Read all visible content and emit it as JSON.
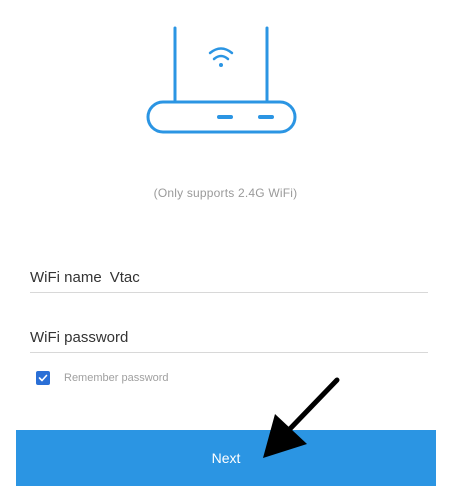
{
  "illustration": {
    "icon": "router-icon",
    "accent_color": "#2b95e3"
  },
  "support_note": "(Only supports 2.4G WiFi)",
  "form": {
    "wifi_name_label": "WiFi name",
    "wifi_name_value": "Vtac",
    "wifi_password_label": "WiFi password",
    "wifi_password_value": "",
    "remember_label": "Remember password",
    "remember_checked": true
  },
  "next_button": {
    "label": "Next",
    "color": "#2b95e3"
  },
  "annotation": {
    "icon": "arrow-pointer-icon",
    "color": "#000000"
  }
}
